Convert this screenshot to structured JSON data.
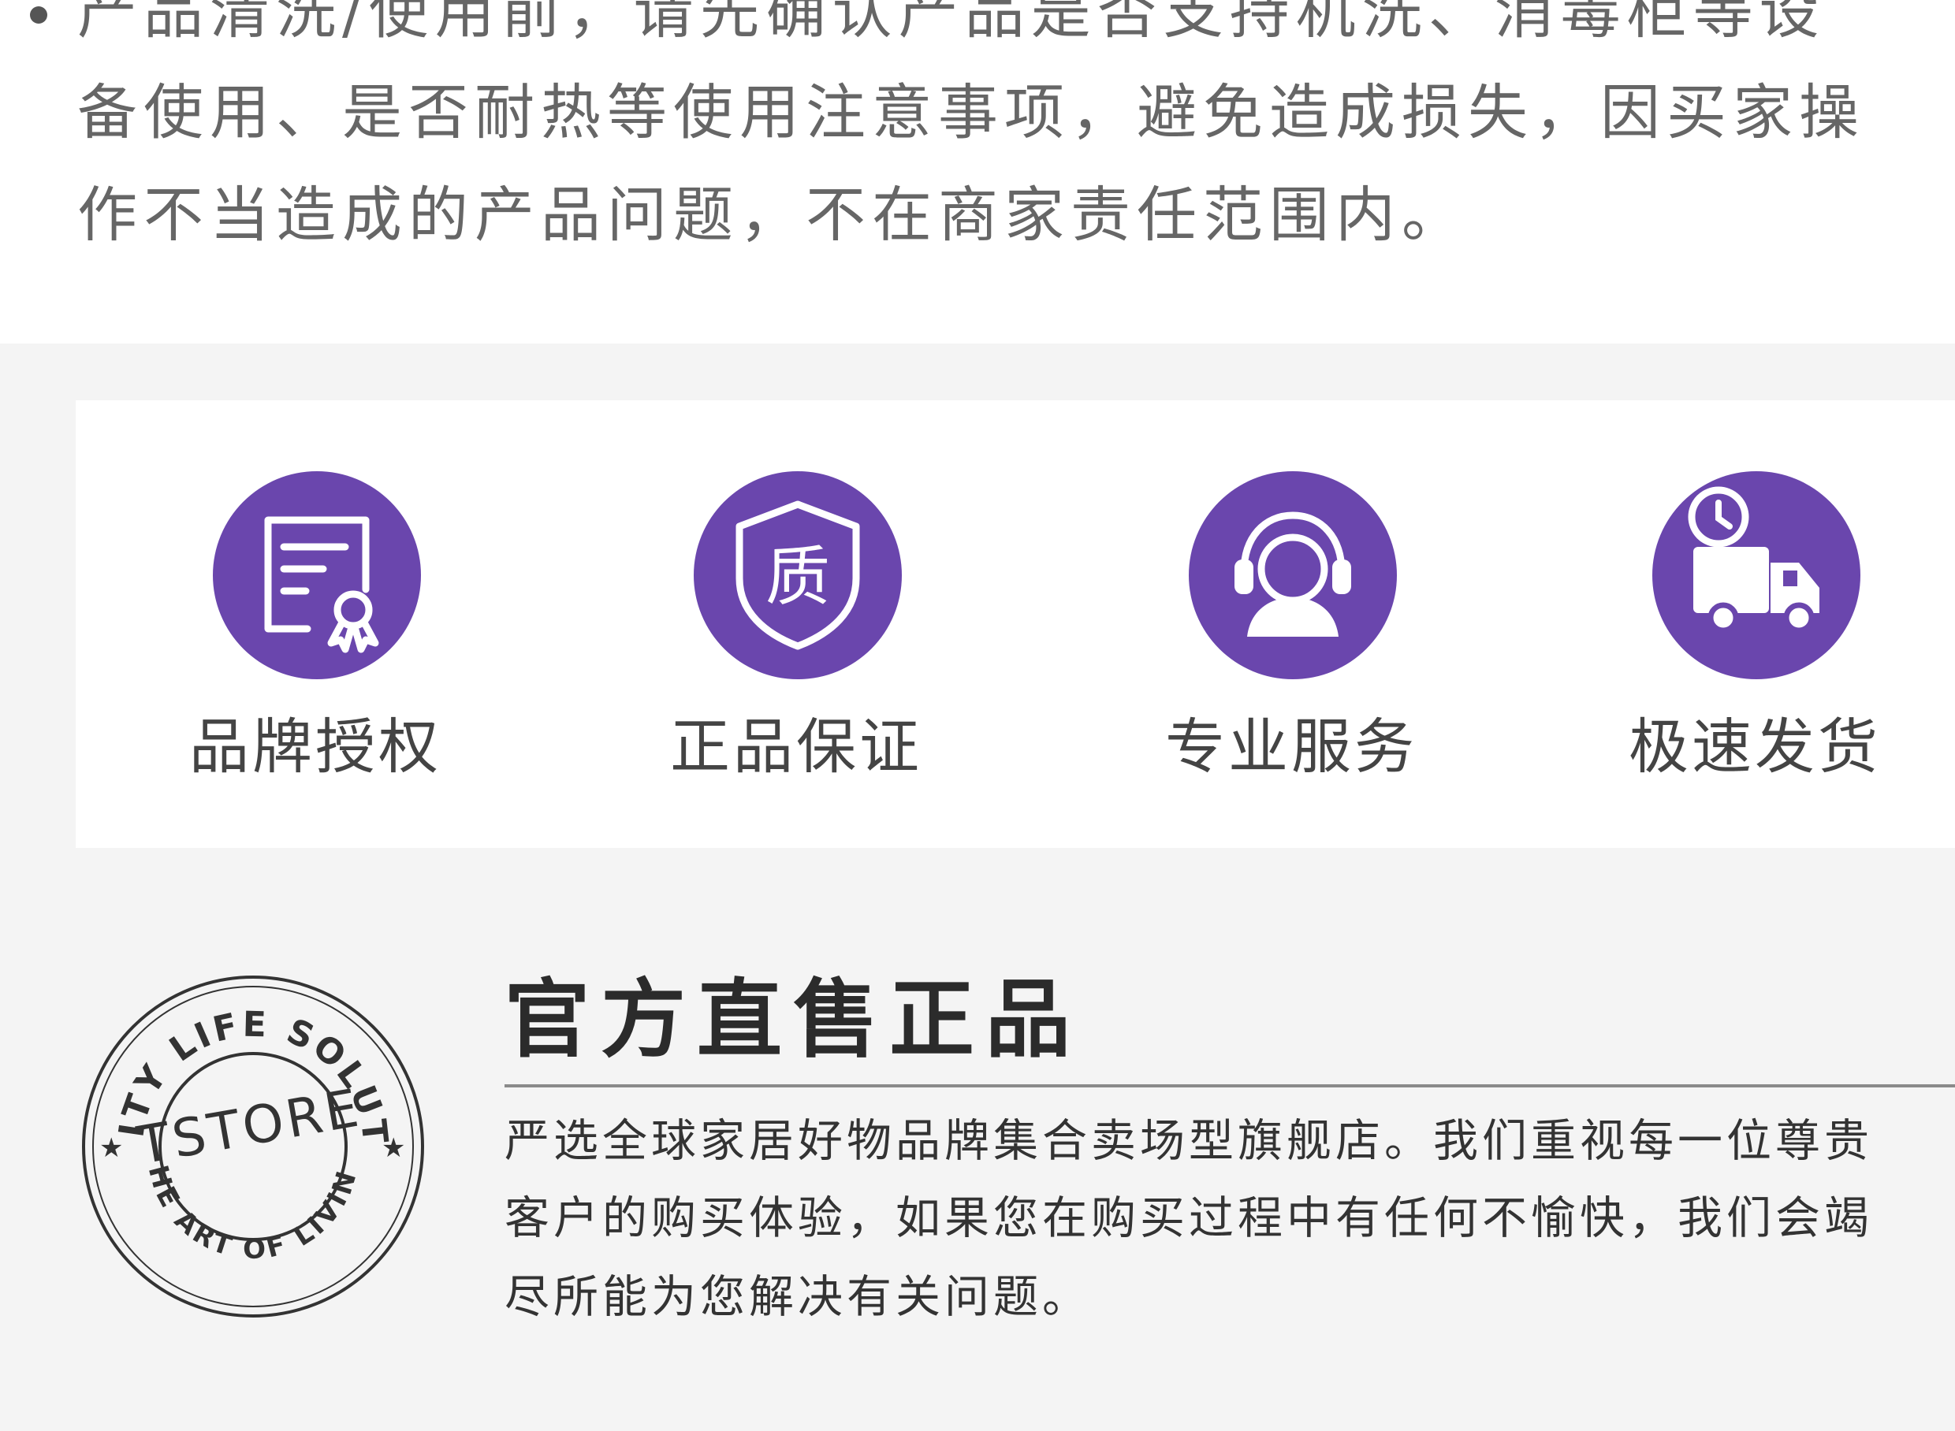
{
  "notice": {
    "lines": [
      "产品清洗/使用前，请先确认产品是否支持机洗、消毒柜等设",
      "备使用、是否耐热等使用注意事项，避免造成损失，因买家操",
      "作不当造成的产品问题，不在商家责任范围内。"
    ]
  },
  "features": [
    {
      "icon": "certificate-award-icon",
      "label": "品牌授权"
    },
    {
      "icon": "quality-shield-icon",
      "icon_text": "质",
      "label": "正品保证"
    },
    {
      "icon": "customer-service-headset-icon",
      "label": "专业服务"
    },
    {
      "icon": "delivery-truck-clock-icon",
      "label": "极速发货"
    }
  ],
  "seal": {
    "top_text": "QUALITY LIFE SOLUTIONS",
    "center_text": "TSTORE",
    "bottom_text": "THE ART OF LIVING"
  },
  "official": {
    "title": "官方直售正品",
    "lines": [
      "严选全球家居好物品牌集合卖场型旗舰店。我们重视每一位尊贵",
      "客户的购买体验，如果您在购买过程中有任何不愉快，我们会竭",
      "尽所能为您解决有关问题。"
    ]
  },
  "colors": {
    "accent_purple": "#6a46ad",
    "section_gray": "#f4f4f4",
    "text_gray": "#666666",
    "text_dark": "#333333"
  }
}
